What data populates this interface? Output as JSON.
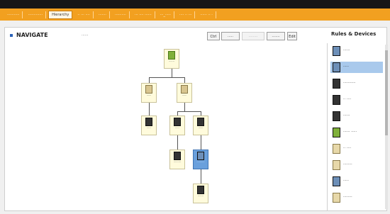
{
  "tabs": [
    {
      "label": "···········"
    },
    {
      "label": "·············"
    },
    {
      "label": "Hierarchy",
      "active": true
    },
    {
      "label": "·· ··· ····"
    },
    {
      "label": "·······"
    },
    {
      "label": "··········"
    },
    {
      "label": "··· ···· ······"
    },
    {
      "label": "···_·····"
    },
    {
      "label": "···· ·· ···"
    },
    {
      "label": "······ ·· ·"
    }
  ],
  "header": {
    "title": "NAVIGATE",
    "subtitle": "······",
    "buttons": [
      "Ctrl",
      "·····",
      "········",
      "·······",
      "Edit"
    ],
    "sidebar_title": "Rules & Devices"
  },
  "nodes": [
    {
      "label": "·······"
    },
    {
      "label": "······"
    },
    {
      "label": "······"
    },
    {
      "label": "·····"
    },
    {
      "label": "·····"
    },
    {
      "label": "······"
    },
    {
      "label": "·········"
    },
    {
      "label": "··········"
    },
    {
      "label": "·······"
    }
  ],
  "sidebar_items": [
    {
      "label": "······"
    },
    {
      "label": "·····"
    },
    {
      "label": "···········"
    },
    {
      "label": "·· ····"
    },
    {
      "label": "······"
    },
    {
      "label": "······ ·····"
    },
    {
      "label": "·· ····"
    },
    {
      "label": "········"
    },
    {
      "label": "·····"
    },
    {
      "label": "········"
    }
  ],
  "colors": {
    "accent": "#f2a020",
    "selection": "#6aa0dc"
  }
}
